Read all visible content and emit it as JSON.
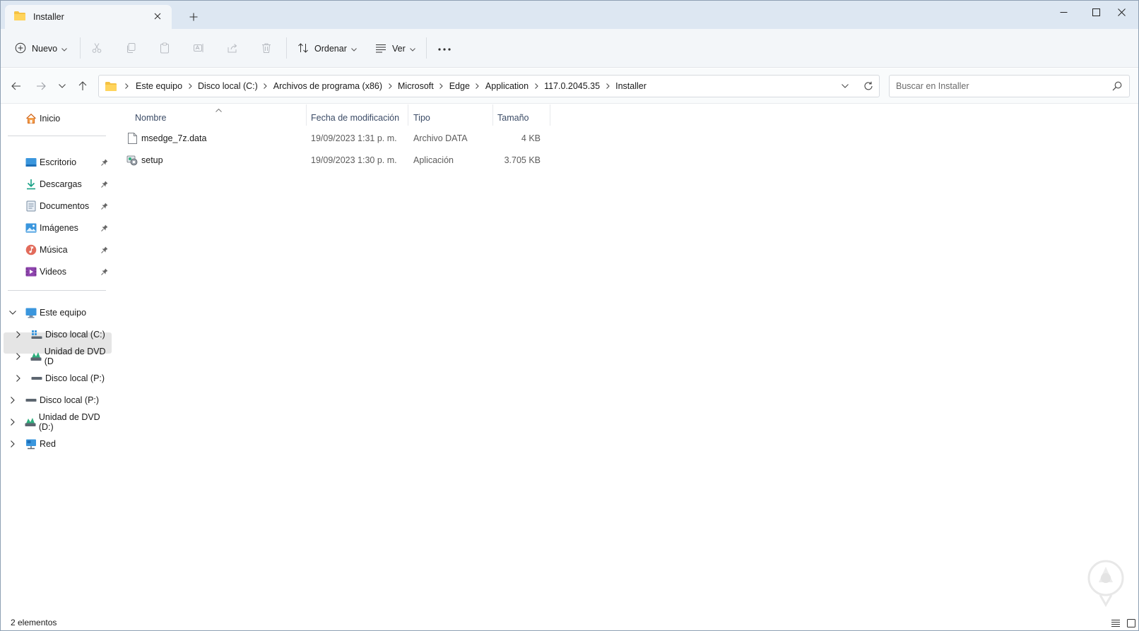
{
  "window": {
    "tab_title": "Installer"
  },
  "toolbar": {
    "new_label": "Nuevo",
    "sort_label": "Ordenar",
    "view_label": "Ver",
    "more_label": "···"
  },
  "address": {
    "crumbs": [
      "Este equipo",
      "Disco local (C:)",
      "Archivos de programa (x86)",
      "Microsoft",
      "Edge",
      "Application",
      "117.0.2045.35",
      "Installer"
    ]
  },
  "search": {
    "placeholder": "Buscar en Installer"
  },
  "sidebar": {
    "home": "Inicio",
    "quick_access": [
      {
        "label": "Escritorio",
        "icon": "desktop-icon"
      },
      {
        "label": "Descargas",
        "icon": "download-icon"
      },
      {
        "label": "Documentos",
        "icon": "documents-icon"
      },
      {
        "label": "Imágenes",
        "icon": "pictures-icon"
      },
      {
        "label": "Música",
        "icon": "music-icon"
      },
      {
        "label": "Videos",
        "icon": "videos-icon"
      }
    ],
    "this_pc": "Este equipo",
    "this_pc_children": [
      "Disco local (C:)",
      "Unidad de DVD (D",
      "Disco local (P:)"
    ],
    "roots": [
      "Disco local (P:)",
      "Unidad de DVD (D:)",
      "Red"
    ]
  },
  "columns": {
    "name": "Nombre",
    "modified": "Fecha de modificación",
    "type": "Tipo",
    "size": "Tamaño"
  },
  "files": [
    {
      "name": "msedge_7z.data",
      "modified": "19/09/2023 1:31 p. m.",
      "type": "Archivo DATA",
      "size": "4 KB",
      "icon": "file-icon"
    },
    {
      "name": "setup",
      "modified": "19/09/2023 1:30 p. m.",
      "type": "Aplicación",
      "size": "3.705 KB",
      "icon": "setup-app-icon"
    }
  ],
  "status": {
    "count": "2 elementos"
  },
  "colors": {
    "titlebar": "#dde7f2",
    "toolbar": "#f3f6f9",
    "accent": "#0067c0",
    "folder": "#f5c242"
  }
}
